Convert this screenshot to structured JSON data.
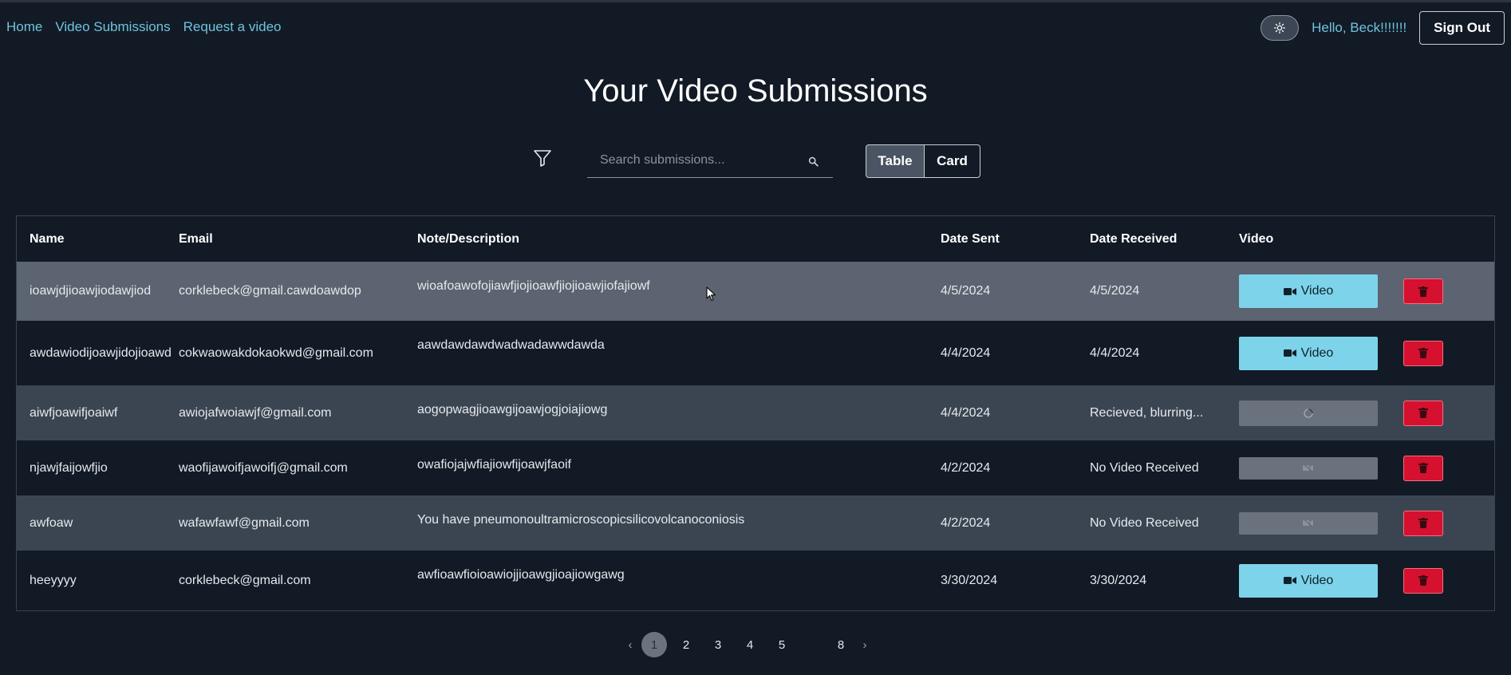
{
  "nav": {
    "home": "Home",
    "video_submissions": "Video Submissions",
    "request_video": "Request a video"
  },
  "user": {
    "greeting": "Hello, Beck!!!!!!!",
    "sign_out": "Sign Out",
    "theme_icon": "sun-icon"
  },
  "page": {
    "title": "Your Video Submissions"
  },
  "search": {
    "placeholder": "Search submissions..."
  },
  "view_toggle": {
    "table": "Table",
    "card": "Card",
    "selected": "Table"
  },
  "table": {
    "headers": {
      "name": "Name",
      "email": "Email",
      "note": "Note/Description",
      "date_sent": "Date Sent",
      "date_received": "Date Received",
      "video": "Video"
    },
    "rows": [
      {
        "name": "ioawjdjioawjiodawjiod",
        "email": "corklebeck@gmail.cawdoawdop",
        "note": "wioafoawofojiawfjiojioawfjiojioawjiofajiowf",
        "date_sent": "4/5/2024",
        "date_received": "4/5/2024",
        "video_label": "Video",
        "video_state": "ready"
      },
      {
        "name": "awdawiodijoawjidojioawd",
        "email": "cokwaowakdokaokwd@gmail.com",
        "note": "aawdawdawdwadwadawwdawda",
        "date_sent": "4/4/2024",
        "date_received": "4/4/2024",
        "video_label": "Video",
        "video_state": "ready"
      },
      {
        "name": "aiwfjoawifjoaiwf",
        "email": "awiojafwoiawjf@gmail.com",
        "note": "aogopwagjioawgijoawjogjoiajiowg",
        "date_sent": "4/4/2024",
        "date_received": "Recieved, blurring...",
        "video_label": "",
        "video_state": "processing"
      },
      {
        "name": "njawjfaijowfjio",
        "email": "waofijawoifjawoifj@gmail.com",
        "note": "owafiojajwfiajiowfijoawjfaoif",
        "date_sent": "4/2/2024",
        "date_received": "No Video Received",
        "video_label": "",
        "video_state": "none"
      },
      {
        "name": "awfoaw",
        "email": "wafawfawf@gmail.com",
        "note": "You have pneumonoultramicroscopicsilicovolcanoconiosis",
        "date_sent": "4/2/2024",
        "date_received": "No Video Received",
        "video_label": "",
        "video_state": "none"
      },
      {
        "name": "heeyyyy",
        "email": "corklebeck@gmail.com",
        "note": "awfioawfioioawiojjioawgjioajiowgawg",
        "date_sent": "3/30/2024",
        "date_received": "3/30/2024",
        "video_label": "Video",
        "video_state": "ready"
      }
    ]
  },
  "pagination": {
    "prev": "‹",
    "next": "›",
    "pages": [
      "1",
      "2",
      "3",
      "4",
      "5",
      "8"
    ],
    "current": "1"
  },
  "colors": {
    "background": "#121a25",
    "accent": "#7dd3ea",
    "delete": "#d6102f",
    "link": "#6fc3de"
  }
}
